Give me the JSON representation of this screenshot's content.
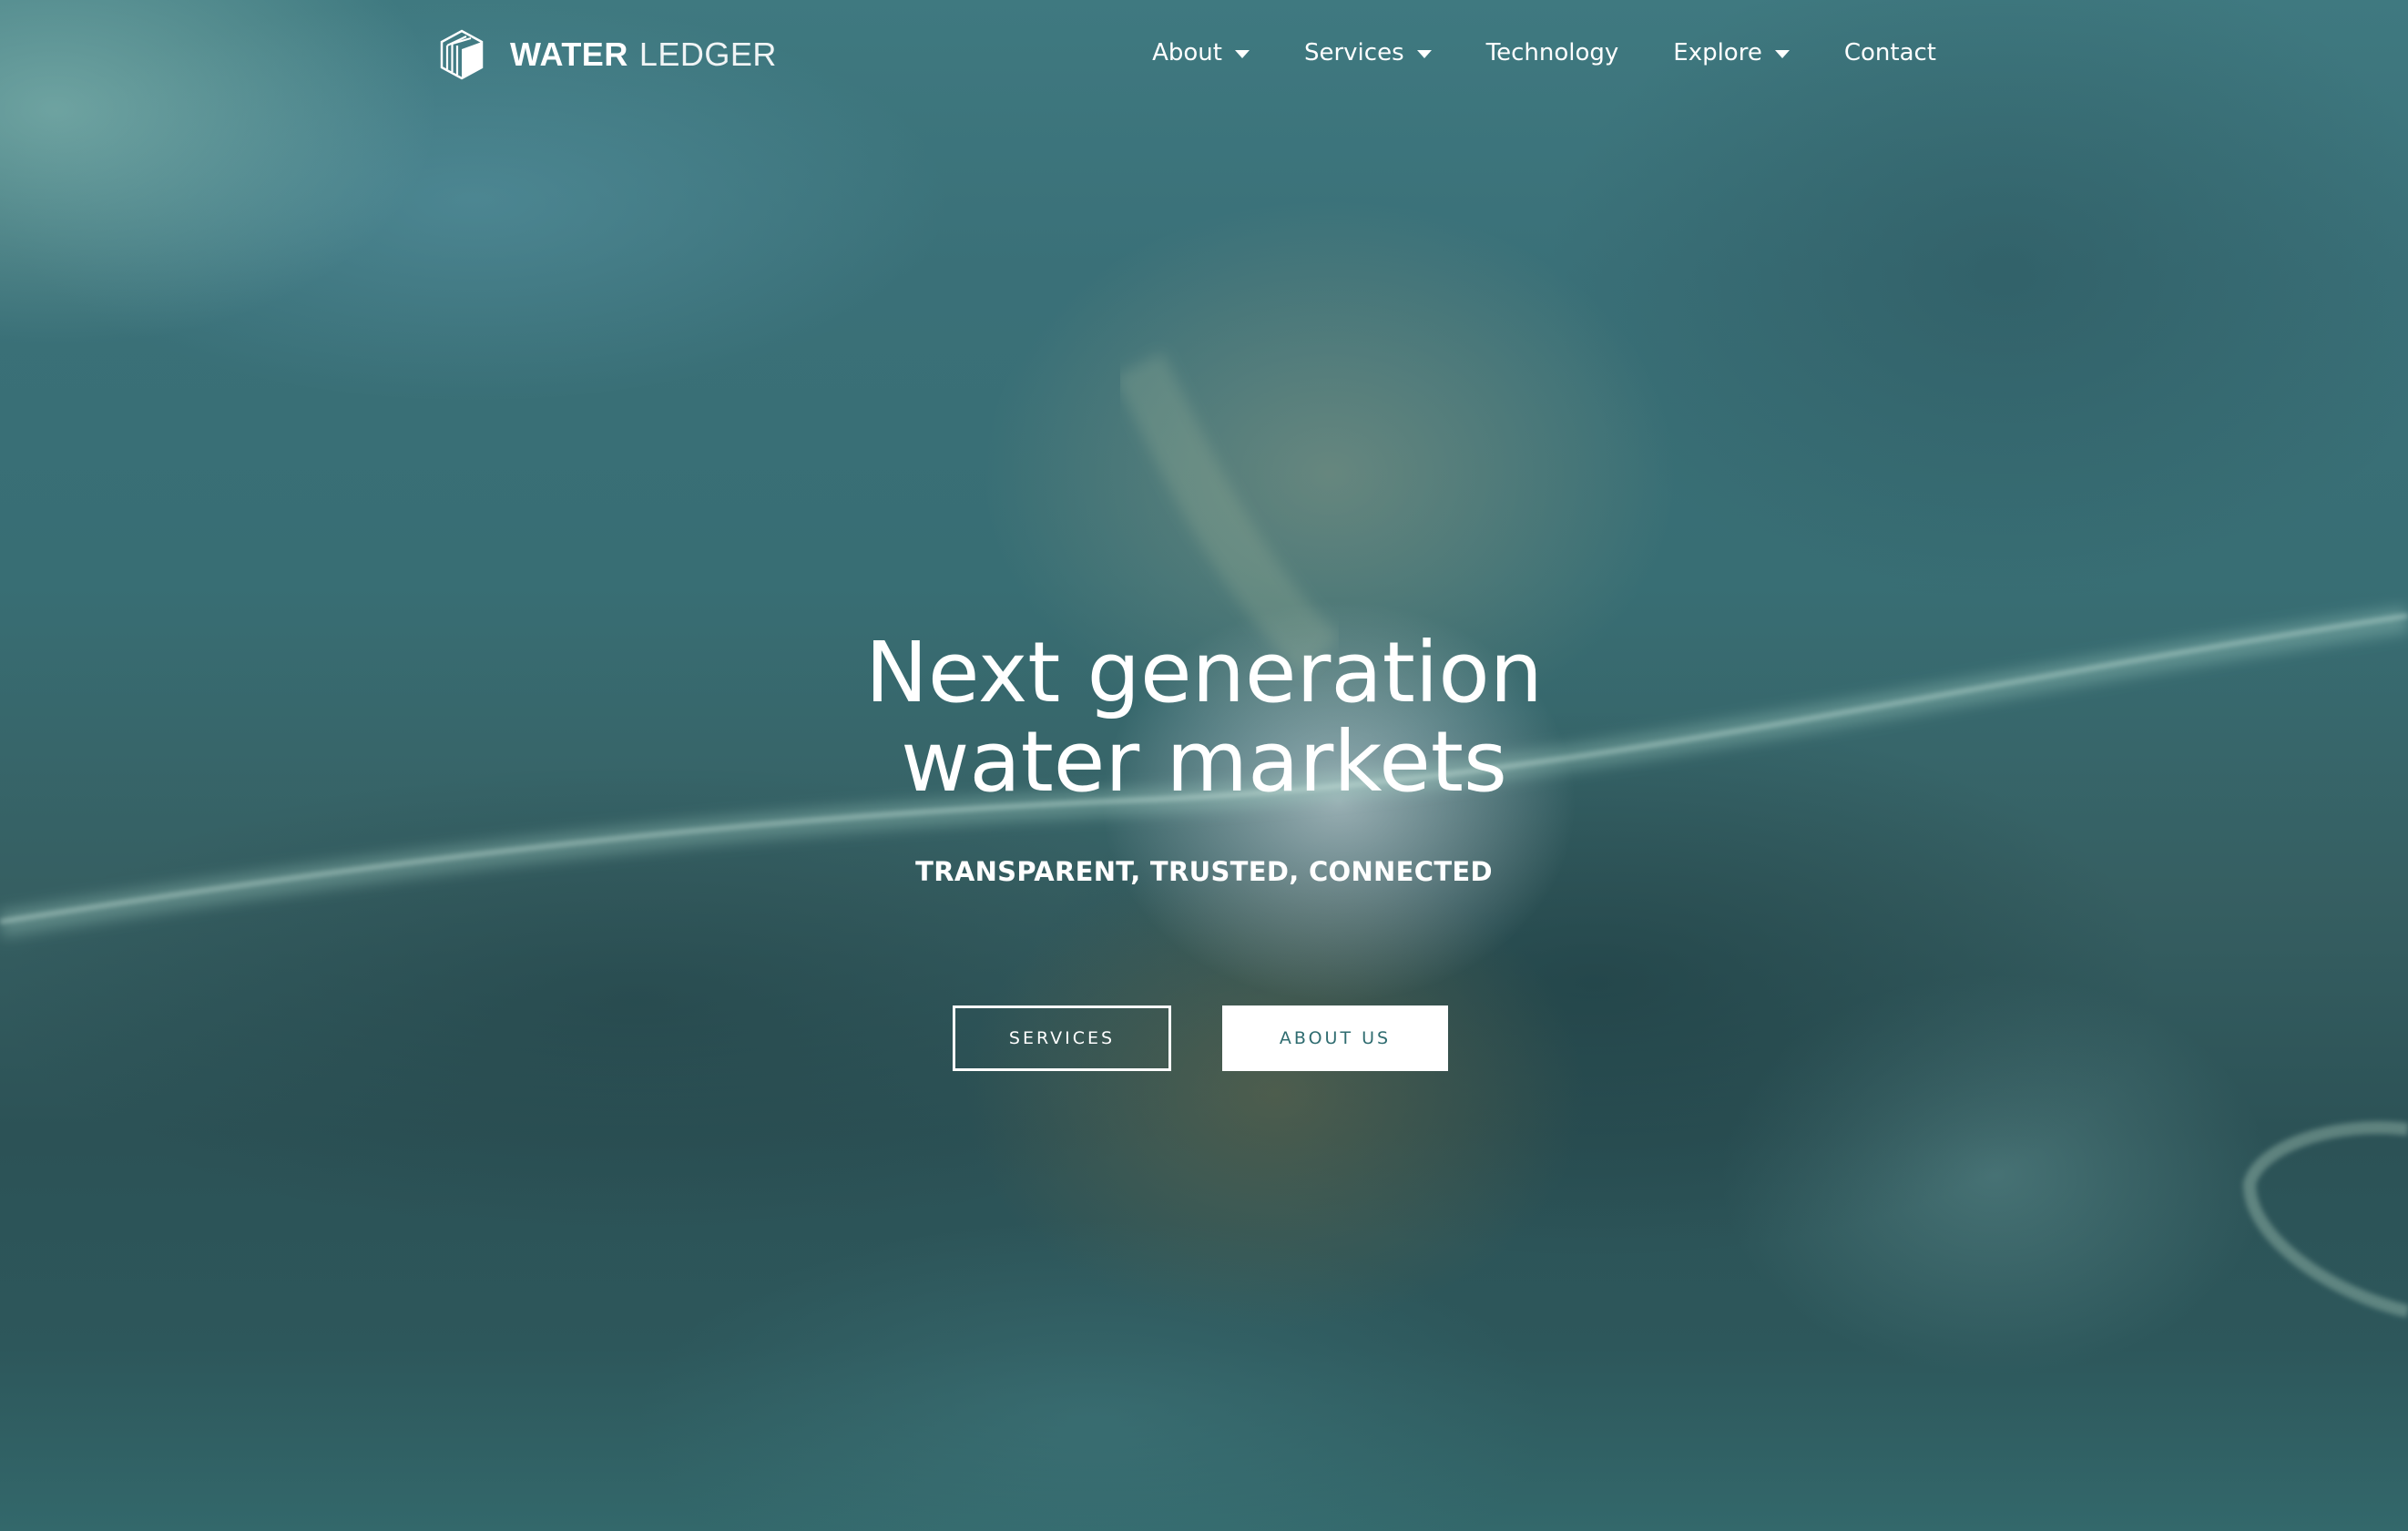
{
  "brand": {
    "name_bold": "WATER",
    "name_light": "LEDGER",
    "logo_icon": "hexagon-stripes-logo-icon"
  },
  "nav": {
    "items": [
      {
        "label": "About",
        "has_dropdown": true
      },
      {
        "label": "Services",
        "has_dropdown": true
      },
      {
        "label": "Technology",
        "has_dropdown": false
      },
      {
        "label": "Explore",
        "has_dropdown": true
      },
      {
        "label": "Contact",
        "has_dropdown": false
      }
    ]
  },
  "hero": {
    "title_line1": "Next generation",
    "title_line2": "water markets",
    "subtitle": "TRANSPARENT, TRUSTED, CONNECTED",
    "buttons": {
      "services_label": "SERVICES",
      "about_label": "ABOUT US"
    }
  },
  "colors": {
    "background": "#386e74",
    "text": "#ffffff",
    "button_text_accent": "#2f6c70"
  }
}
